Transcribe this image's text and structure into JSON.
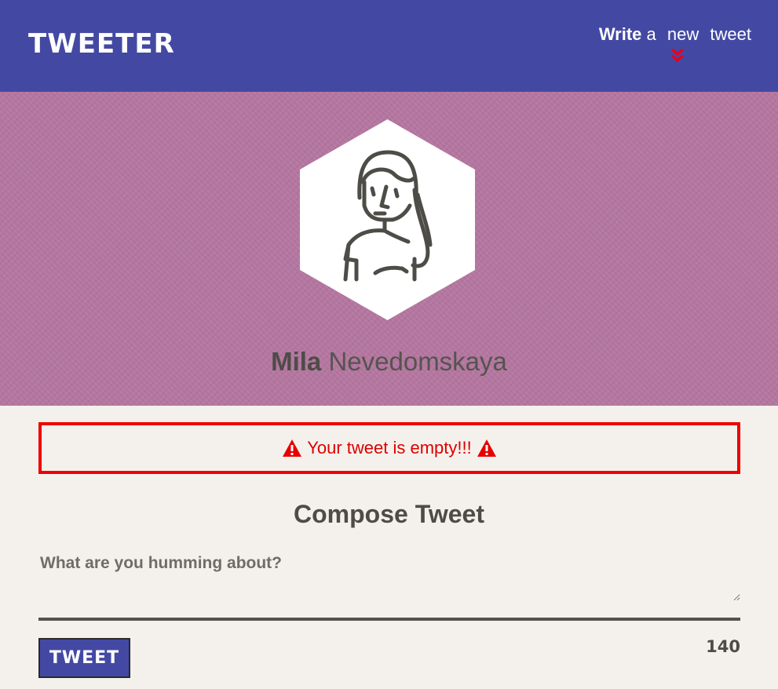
{
  "nav": {
    "logo": "TWEETER",
    "cta": {
      "w1": "Write",
      "w2": "a",
      "w3": "new",
      "w4": "tweet"
    },
    "chevron_icon": "double-chevron-down",
    "chevron_color": "#e8001c"
  },
  "profile": {
    "first_name": "Mila",
    "last_name": "Nevedomskaya",
    "avatar_icon": "woman-avatar"
  },
  "error": {
    "message": "Your tweet is empty!!!",
    "icon": "warning-triangle",
    "color": "#ee0000"
  },
  "compose": {
    "title": "Compose Tweet",
    "placeholder": "What are you humming about?",
    "value": "",
    "button_label": "TWEET",
    "counter": "140"
  },
  "colors": {
    "nav_bg": "#4349a3",
    "hero_bg": "#b476a0",
    "page_bg": "#f4f1ec",
    "text": "#4d4c47"
  }
}
